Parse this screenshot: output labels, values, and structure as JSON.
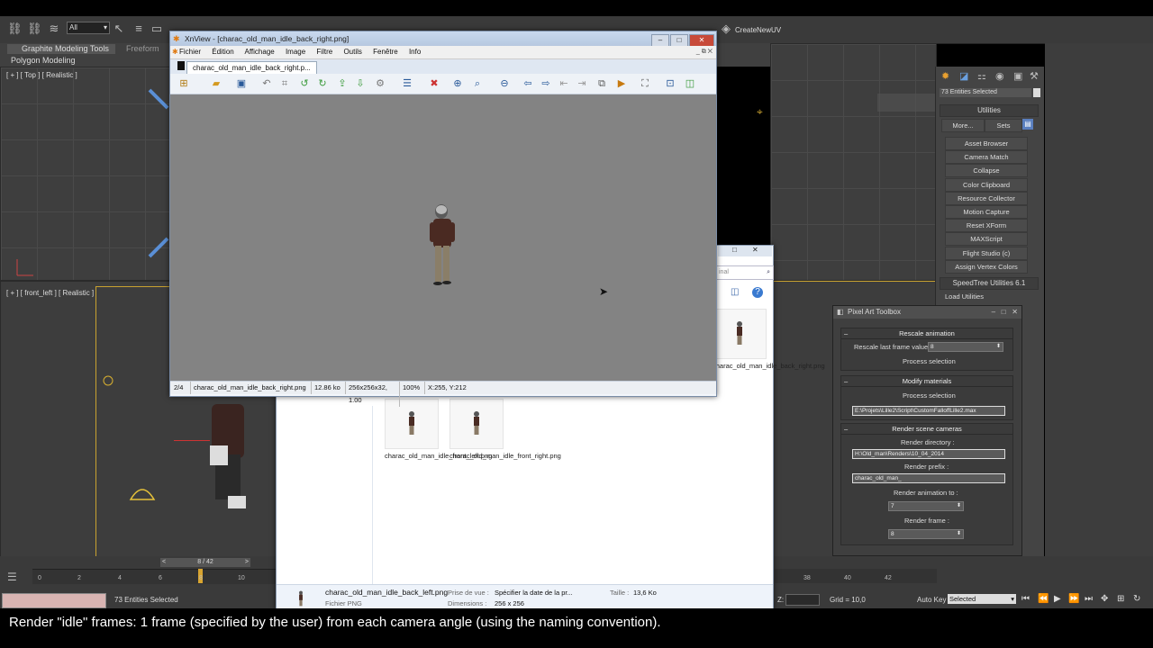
{
  "max": {
    "toolbar": {
      "selection_filter": "All",
      "create_new_uv": "CreateNewUV"
    },
    "ribbon": {
      "tab_graphite": "Graphite Modeling Tools",
      "tab_freeform": "Freeform",
      "polygon_modeling": "Polygon Modeling"
    },
    "viewports": {
      "top_label": "[ + ] [ Top ] [ Realistic ]",
      "front_left_label": "[ + ] [ front_left ] [ Realistic ]"
    },
    "command_panel": {
      "selection_field": "73 Entities Selected",
      "utilities_header": "Utilities",
      "more_button": "More...",
      "sets_button": "Sets",
      "buttons": [
        "Asset Browser",
        "Camera Match",
        "Collapse",
        "Color Clipboard",
        "Resource Collector",
        "Motion Capture",
        "Reset XForm",
        "MAXScript",
        "Flight Studio (c)",
        "Assign Vertex Colors"
      ],
      "speedtree_header": "SpeedTree Utilities 6.1",
      "load_utilities": "Load Utilities"
    },
    "timeline": {
      "frame_counter": "8 / 42",
      "ticks": [
        "0",
        "2",
        "4",
        "6",
        "8",
        "10"
      ],
      "ticks_right": [
        "38",
        "40",
        "42"
      ]
    },
    "status": {
      "entities_selected": "73 Entities Selected",
      "z_label": "Z:",
      "grid": "Grid = 10,0",
      "auto_key": "Auto Key",
      "auto_key_select": "Selected"
    }
  },
  "xnview": {
    "title": "XnView - [charac_old_man_idle_back_right.png]",
    "menu": [
      "Fichier",
      "Édition",
      "Affichage",
      "Image",
      "Filtre",
      "Outils",
      "Fenêtre",
      "Info"
    ],
    "tab": "charac_old_man_idle_back_right.p...",
    "status": {
      "index": "2/4",
      "filename": "charac_old_man_idle_back_right.png",
      "size": "12.86 ko",
      "dims": "256x256x32, 1.00",
      "zoom": "100%",
      "coords": "X:255, Y:212"
    }
  },
  "explorer": {
    "search_placeholder": "inal",
    "thumbs": [
      {
        "label": "charac_old_man_idle_back_right.png"
      },
      {
        "label": "charac_old_man_idle_front_left.png"
      },
      {
        "label": "charac_old_man_idle_front_right.png"
      }
    ],
    "details": {
      "filename": "charac_old_man_idle_back_left.png",
      "filetype": "Fichier PNG",
      "prise_label": "Prise de vue :",
      "prise_value": "Spécifier la date de la pr...",
      "dims_label": "Dimensions :",
      "dims_value": "256 x 256",
      "size_label": "Taille :",
      "size_value": "13,6 Ko"
    }
  },
  "pixel_art_toolbox": {
    "title": "Pixel Art Toolbox",
    "rescale": {
      "header": "Rescale animation",
      "label": "Rescale last frame value",
      "value": "8",
      "button": "Process selection"
    },
    "materials": {
      "header": "Modify materials",
      "button": "Process selection",
      "path": "E:\\Projets\\Lille2\\Script\\CustomFalloffLille2.max"
    },
    "cameras": {
      "header": "Render scene cameras",
      "dir_label": "Render directory :",
      "dir_value": "H:\\Old_man\\Renders\\10_04_2014",
      "prefix_label": "Render prefix :",
      "prefix_value": "charac_old_man_",
      "anim_label": "Render animation to :",
      "anim_value": "7",
      "frame_label": "Render frame :",
      "frame_value": "8"
    }
  },
  "caption": "Render \"idle\" frames: 1 frame (specified by the user) from each camera angle (using the naming convention)."
}
